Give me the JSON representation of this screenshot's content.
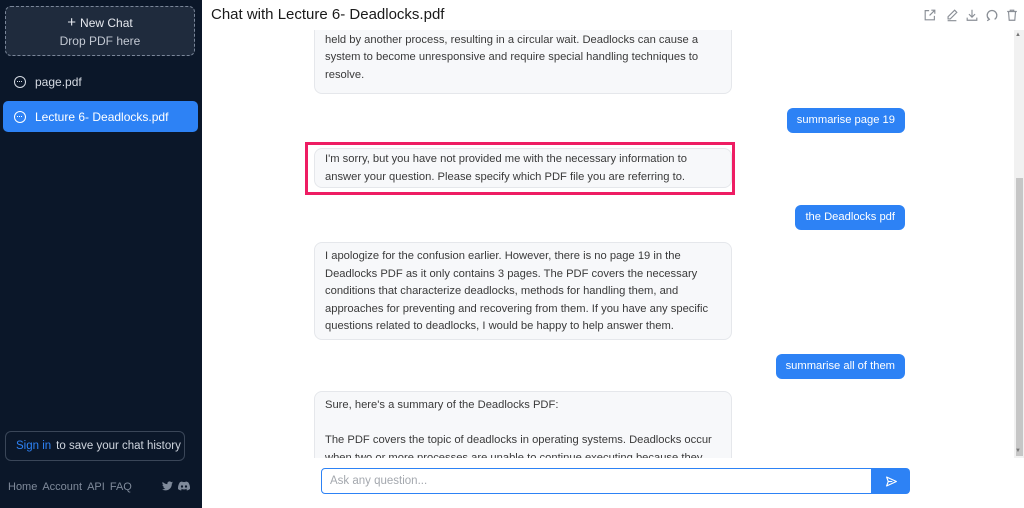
{
  "sidebar": {
    "new_chat": {
      "label": "New Chat",
      "sub": "Drop PDF here"
    },
    "items": [
      {
        "label": "page.pdf"
      },
      {
        "label": "Lecture 6- Deadlocks.pdf"
      }
    ],
    "signin": {
      "link": "Sign in",
      "text": "to save your chat history"
    },
    "footer": [
      "Home",
      "Account",
      "API",
      "FAQ"
    ]
  },
  "header": {
    "title": "Chat with Lecture 6- Deadlocks.pdf"
  },
  "messages": {
    "m1": [
      "held by another process, resulting in a circular wait. Deadlocks can cause a",
      "system to become unresponsive and require special handling techniques to",
      "resolve."
    ],
    "u1": "summarise page 19",
    "m2": [
      "I'm sorry, but you have not provided me with the necessary information to",
      "answer your question. Please specify which PDF file you are referring to."
    ],
    "u2": "the Deadlocks pdf",
    "m3": [
      "I apologize for the confusion earlier. However, there is no page 19 in the",
      "Deadlocks PDF as it only contains 3 pages. The PDF covers the necessary",
      "conditions that characterize deadlocks, methods for handling them, and",
      "approaches for preventing and recovering from them. If you have any specific",
      "questions related to deadlocks, I would be happy to help answer them."
    ],
    "u3": "summarise all of them",
    "m4": [
      "Sure, here's a summary of the Deadlocks PDF:",
      "",
      "The PDF covers the topic of deadlocks in operating systems. Deadlocks occur",
      "when two or more processes are unable to continue executing because they are"
    ]
  },
  "input": {
    "placeholder": "Ask any question..."
  },
  "icons": {
    "share": "share-icon",
    "edit": "pencil-icon",
    "download": "download-icon",
    "refresh": "refresh-icon",
    "delete": "trash-icon",
    "send": "send-icon",
    "twitter": "twitter-icon",
    "discord": "discord-icon"
  },
  "colors": {
    "accent": "#2d82f5",
    "highlight": "#ee1d63",
    "sidebar": "#0b1729"
  }
}
